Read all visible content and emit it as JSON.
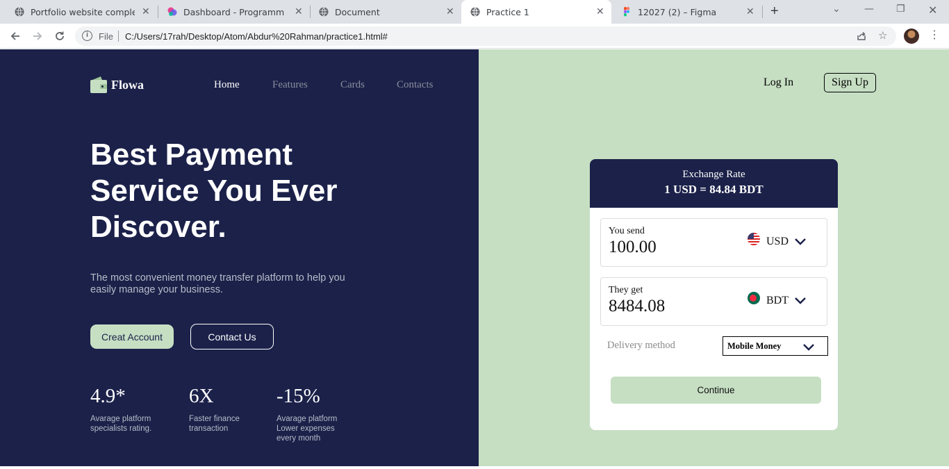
{
  "browser": {
    "tabs": [
      {
        "title": "Portfolio website complete",
        "icon": "globe-icon"
      },
      {
        "title": "Dashboard - Programming H",
        "icon": "app-logo-icon"
      },
      {
        "title": "Document",
        "icon": "globe-icon"
      },
      {
        "title": "Practice 1",
        "icon": "globe-icon",
        "active": true
      },
      {
        "title": "12027 (2) – Figma",
        "icon": "figma-icon"
      }
    ],
    "address": {
      "scheme_label": "File",
      "url": "C:/Users/17rah/Desktop/Atom/Abdur%20Rahman/practice1.html#"
    }
  },
  "site": {
    "brand": "Flowa",
    "nav": [
      "Home",
      "Features",
      "Cards",
      "Contacts"
    ],
    "auth": {
      "login": "Log In",
      "signup": "Sign Up"
    },
    "hero": {
      "title_line1": "Best Payment",
      "title_line2": "Service You Ever",
      "title_line3": "Discover.",
      "subtitle": "The most convenient money transfer platform to help you easily manage your business.",
      "primary_cta": "Creat Account",
      "secondary_cta": "Contact Us"
    },
    "stats": [
      {
        "value": "4.9*",
        "line1": "Avarage platform",
        "line2": "specialists rating.",
        "line3": ""
      },
      {
        "value": "6X",
        "line1": "Faster finance",
        "line2": "transaction",
        "line3": ""
      },
      {
        "value": "-15%",
        "line1": "Avarage platform",
        "line2": "Lower expenses",
        "line3": "every month"
      }
    ],
    "exchange": {
      "header_label": "Exchange Rate",
      "rate": "1 USD = 84.84 BDT",
      "send": {
        "label": "You send",
        "amount": "100.00",
        "currency": "USD"
      },
      "get": {
        "label": "They get",
        "amount": "8484.08",
        "currency": "BDT"
      },
      "delivery_label": "Delivery method",
      "delivery_value": "Mobile Money",
      "continue": "Continue"
    }
  },
  "colors": {
    "navy": "#1b2149",
    "mint": "#c6dfc3"
  }
}
